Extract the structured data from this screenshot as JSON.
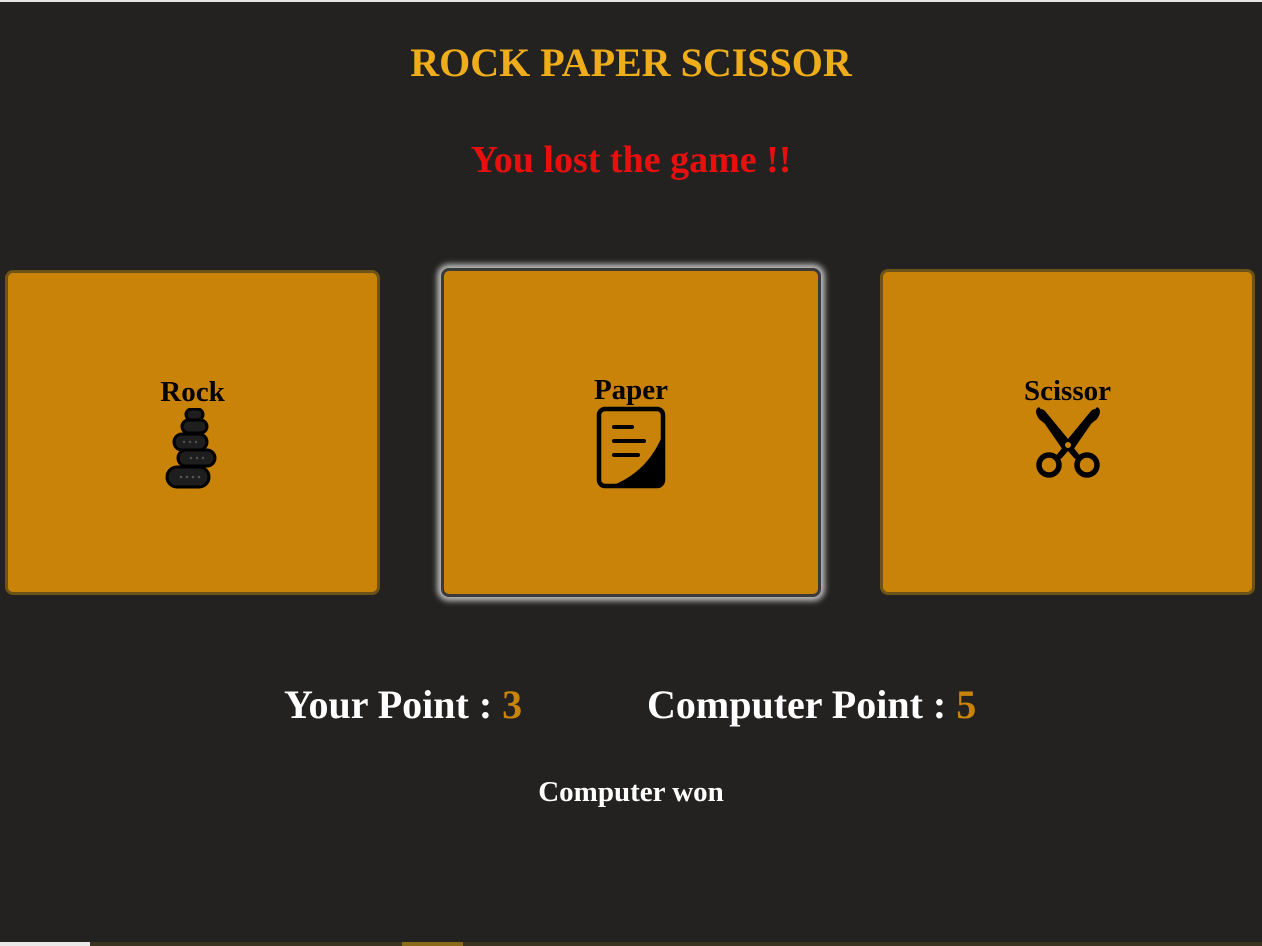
{
  "title": "ROCK PAPER SCISSOR",
  "message": "You lost the game !!",
  "choices": [
    {
      "label": "Rock",
      "icon": "rock-stack-icon"
    },
    {
      "label": "Paper",
      "icon": "paper-document-icon"
    },
    {
      "label": "Scissor",
      "icon": "scissors-icon"
    }
  ],
  "selected_choice": "Paper",
  "score": {
    "your_label": "Your Point :",
    "your_value": "3",
    "computer_label": "Computer Point :",
    "computer_value": "5"
  },
  "result": "Computer won",
  "colors": {
    "background": "#232221",
    "title": "#f0ad1a",
    "message": "#e8100f",
    "card": "#c98309",
    "score_value": "#c98309",
    "text": "#ffffff"
  }
}
